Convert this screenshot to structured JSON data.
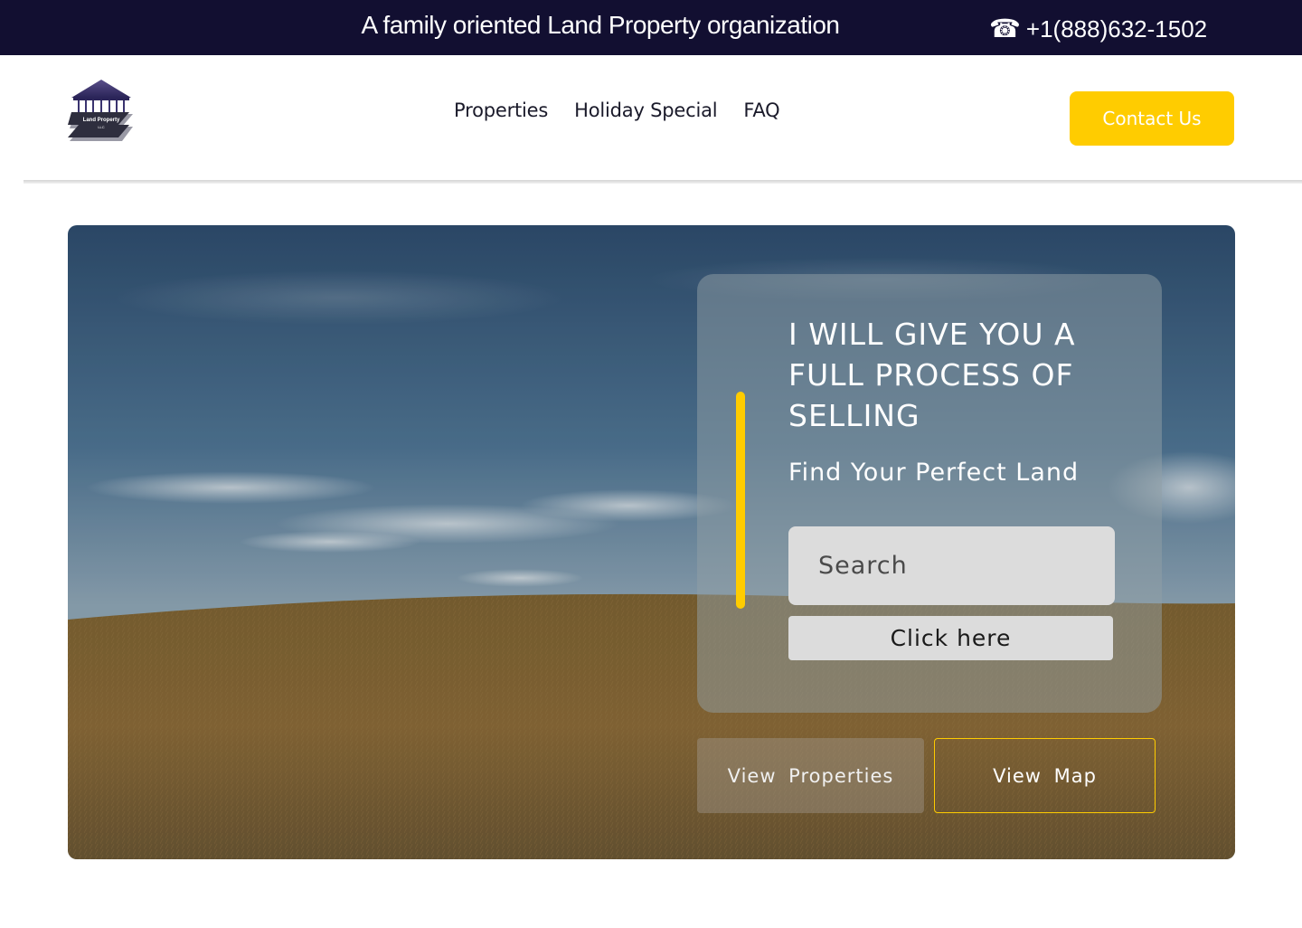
{
  "topbar": {
    "tagline": "A  family oriented Land Property organization",
    "phone_icon": "phone-icon",
    "phone_glyph": "☎",
    "phone": "+1(888)632-1502",
    "background": "#120f31"
  },
  "header": {
    "logo_text": "Land Property",
    "logo_sub": "LLC",
    "nav": [
      {
        "label": "Properties"
      },
      {
        "label": "Holiday Special"
      },
      {
        "label": "FAQ"
      }
    ],
    "contact_label": "Contact Us",
    "accent": "#ffcc00"
  },
  "hero": {
    "title": "I WILL GIVE YOU A FULL PROCESS OF SELLING",
    "subtitle": "Find Your Perfect Land",
    "search_placeholder": "Search",
    "click_label": "Click here",
    "view_properties_label": "View  Properties",
    "view_map_label": "View  Map"
  }
}
